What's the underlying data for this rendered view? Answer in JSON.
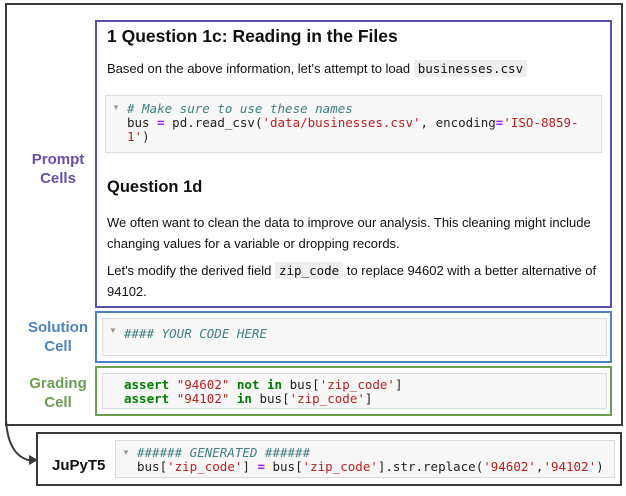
{
  "labels": {
    "prompt": "Prompt\nCells",
    "solution": "Solution\nCell",
    "grading": "Grading\nCell",
    "jupyt5": "JuPyT5"
  },
  "prompt_cell": {
    "q1c_heading": "1  Question 1c: Reading in the Files",
    "q1c_text": "Based on the above information, let's attempt to load",
    "q1c_inline_code": "businesses.csv",
    "code": {
      "comment": "# Make sure to use these names",
      "line2_a": "bus ",
      "line2_eq": "=",
      "line2_b": " pd.read_csv(",
      "line2_str1": "'data/businesses.csv'",
      "line2_c": ", encoding",
      "line2_eq2": "=",
      "line2_str2": "'ISO-8859-",
      "line3_str": "1'",
      "line3_rest": ")"
    },
    "q1d_heading": "Question 1d",
    "q1d_para1": "We often want to clean the data to improve our analysis. This cleaning might include changing values for a variable or dropping records.",
    "q1d_para2_a": "Let's modify the derived field",
    "q1d_para2_code": "zip_code",
    "q1d_para2_b": "to replace 94602 with a better alternative of 94102."
  },
  "solution_cell": {
    "comment": "#### YOUR CODE HERE"
  },
  "grading_cell": {
    "l1_kw": "assert",
    "l1_str": "\"94602\"",
    "l1_op": "not in",
    "l1_rest": " bus[",
    "l1_key": "'zip_code'",
    "l1_end": "]",
    "l2_kw": "assert",
    "l2_str": "\"94102\"",
    "l2_op": "in",
    "l2_rest": " bus[",
    "l2_key": "'zip_code'",
    "l2_end": "]"
  },
  "jupyt5_cell": {
    "comment": "###### GENERATED ######",
    "l2_a": "bus[",
    "l2_key1": "'zip_code'",
    "l2_b": "] ",
    "l2_eq": "=",
    "l2_c": " bus[",
    "l2_key2": "'zip_code'",
    "l2_d": "].str.replace(",
    "l2_s1": "'94602'",
    "l2_e": ",",
    "l2_s2": "'94102'",
    "l2_f": ")"
  },
  "colors": {
    "prompt": "#5e4da8",
    "solution": "#4d84bf",
    "grading": "#6a9f50",
    "frame": "#3a3a3a"
  },
  "icons": [
    "collapse-arrow-icon",
    "flow-arrow-icon"
  ]
}
